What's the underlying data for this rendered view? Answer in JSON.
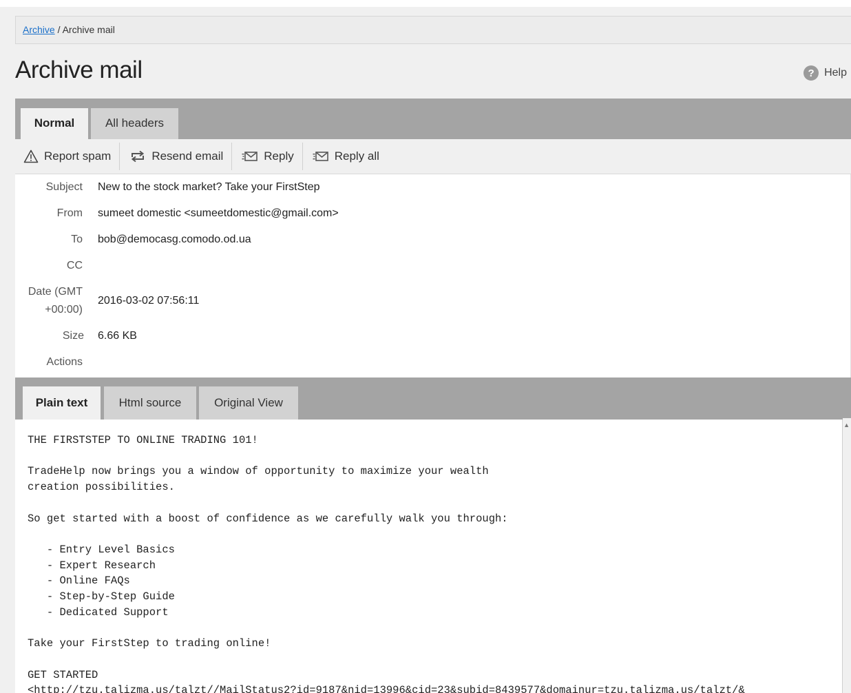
{
  "breadcrumb": {
    "parent": "Archive",
    "separator": "/",
    "current": "Archive mail"
  },
  "page": {
    "title": "Archive mail",
    "help_label": "Help",
    "help_glyph": "?"
  },
  "header_tabs": [
    {
      "label": "Normal",
      "active": true
    },
    {
      "label": "All headers",
      "active": false
    }
  ],
  "toolbar": {
    "report_spam": "Report spam",
    "resend_email": "Resend email",
    "reply": "Reply",
    "reply_all": "Reply all"
  },
  "details": {
    "subject_label": "Subject",
    "subject": "New to the stock market? Take your FirstStep",
    "from_label": "From",
    "from": "sumeet domestic <sumeetdomestic@gmail.com>",
    "to_label": "To",
    "to": "bob@democasg.comodo.od.ua",
    "cc_label": "CC",
    "cc": "",
    "date_label_line1": "Date (GMT",
    "date_label_line2": "+00:00)",
    "date": "2016-03-02 07:56:11",
    "size_label": "Size",
    "size": "6.66 KB",
    "actions_label": "Actions"
  },
  "body_tabs": [
    {
      "label": "Plain text",
      "active": true
    },
    {
      "label": "Html source",
      "active": false
    },
    {
      "label": "Original View",
      "active": false
    }
  ],
  "message_body": "THE FIRSTSTEP TO ONLINE TRADING 101!\n\nTradeHelp now brings you a window of opportunity to maximize your wealth\ncreation possibilities.\n\nSo get started with a boost of confidence as we carefully walk you through:\n\n   - Entry Level Basics\n   - Expert Research\n   - Online FAQs\n   - Step-by-Step Guide\n   - Dedicated Support\n\nTake your FirstStep to trading online!\n\nGET STARTED\n<http://tzu.talizma.us/talzt//MailStatus2?id=9187&nid=13996&cid=23&subid=8439577&domainur=tzu.talizma.us/talzt/&",
  "colors": {
    "link": "#1a6fc9",
    "tabbar": "#a4a4a4",
    "active_tab": "#f0f0f0"
  }
}
